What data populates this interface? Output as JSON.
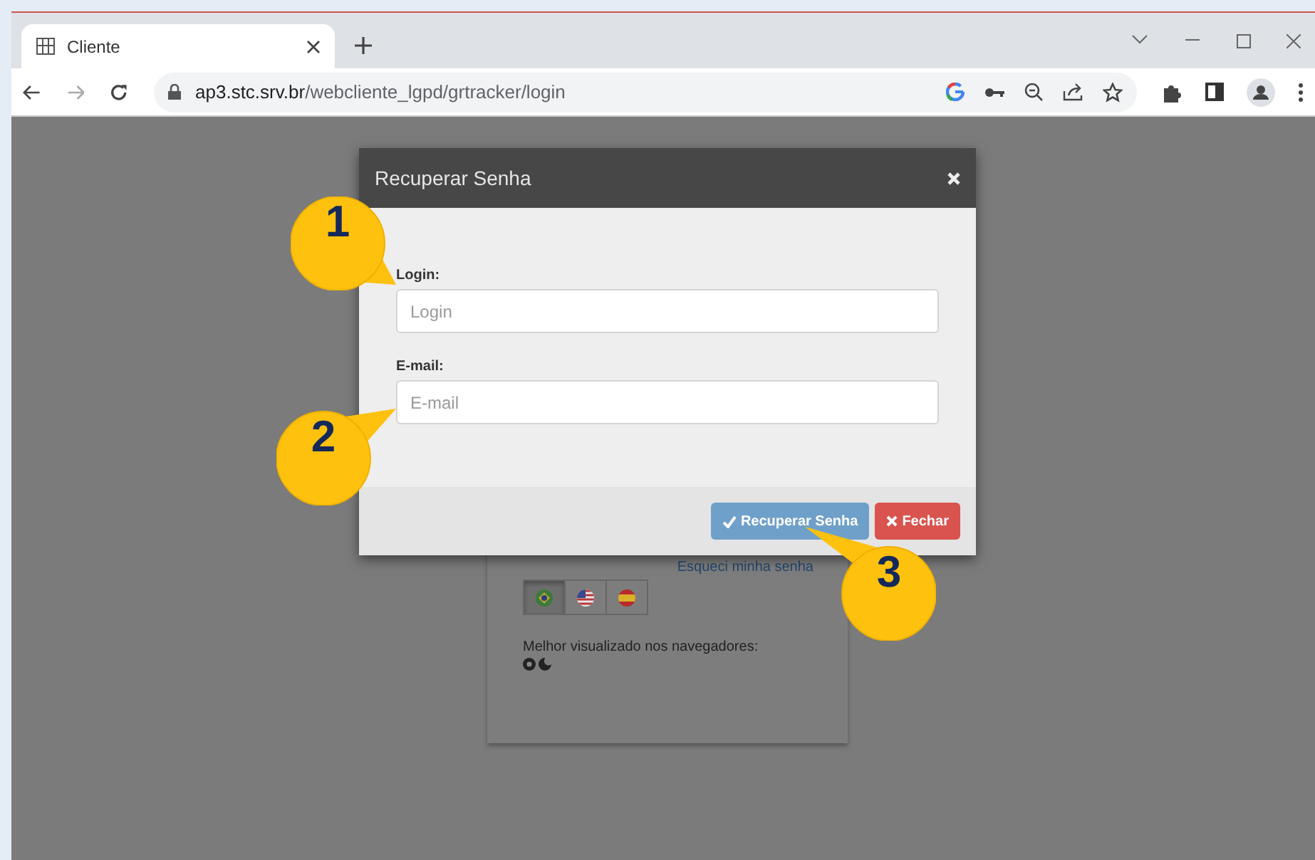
{
  "browser": {
    "tab": {
      "title": "Cliente",
      "selected": true
    },
    "url_host": "ap3.stc.srv.br",
    "url_path": "/webcliente_lgpd/grtracker/login"
  },
  "login_card": {
    "forgot_link": "Esqueci minha senha",
    "languages": [
      {
        "kind": "brazil",
        "selected": true
      },
      {
        "kind": "usa",
        "selected": false
      },
      {
        "kind": "spain",
        "selected": false
      }
    ],
    "browsers_note": "Melhor visualizado nos navegadores:"
  },
  "modal": {
    "title": "Recuperar Senha",
    "fields": [
      {
        "label": "Login:",
        "placeholder": "Login"
      },
      {
        "label": "E-mail:",
        "placeholder": "E-mail"
      }
    ],
    "buttons": [
      {
        "label": "Recuperar Senha",
        "kind": "primary"
      },
      {
        "label": "Fechar",
        "kind": "danger"
      }
    ]
  },
  "callouts": [
    "1",
    "2",
    "3"
  ]
}
